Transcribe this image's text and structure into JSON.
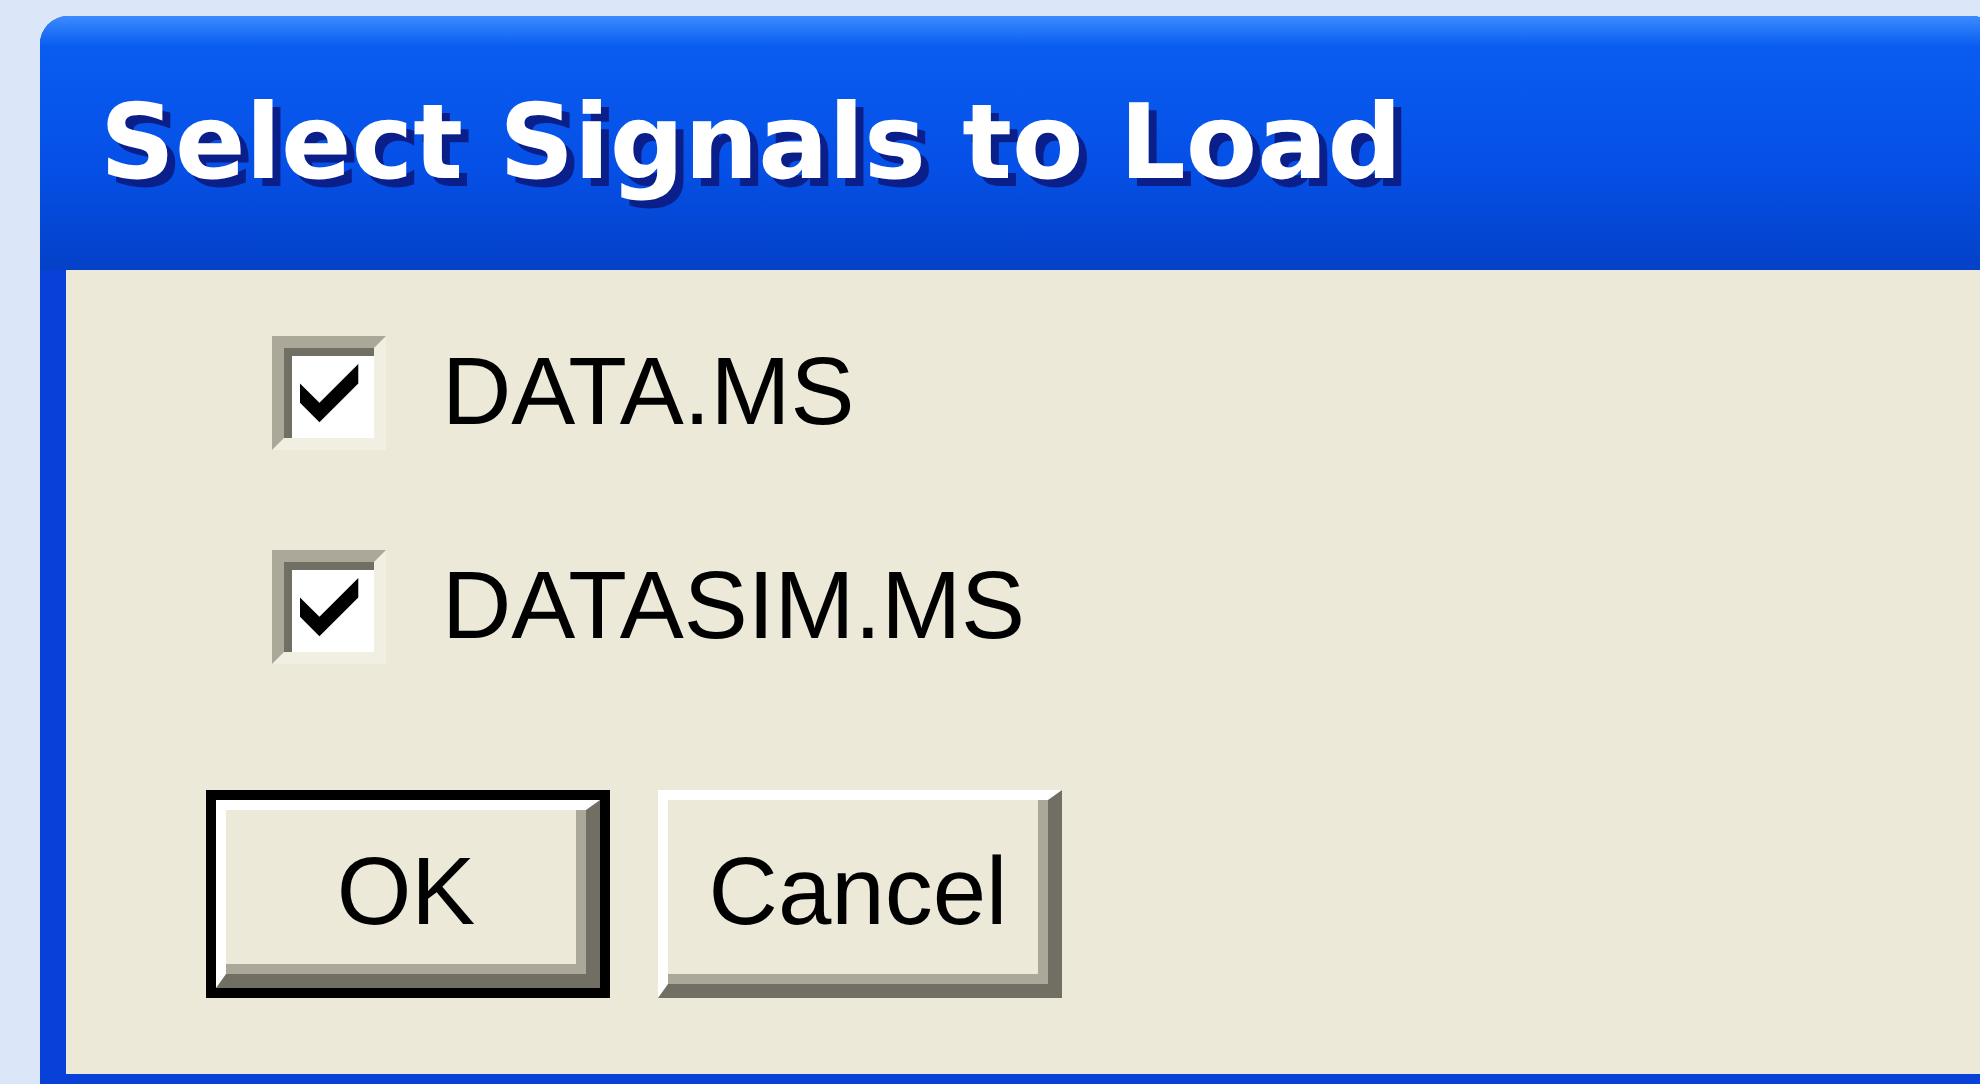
{
  "window": {
    "title": "Select Signals to Load"
  },
  "signals": [
    {
      "label": "DATA.MS",
      "checked": true
    },
    {
      "label": "DATASIM.MS",
      "checked": true
    }
  ],
  "buttons": [
    {
      "label": "OK",
      "default": true
    },
    {
      "label": "Cancel",
      "default": false
    }
  ]
}
